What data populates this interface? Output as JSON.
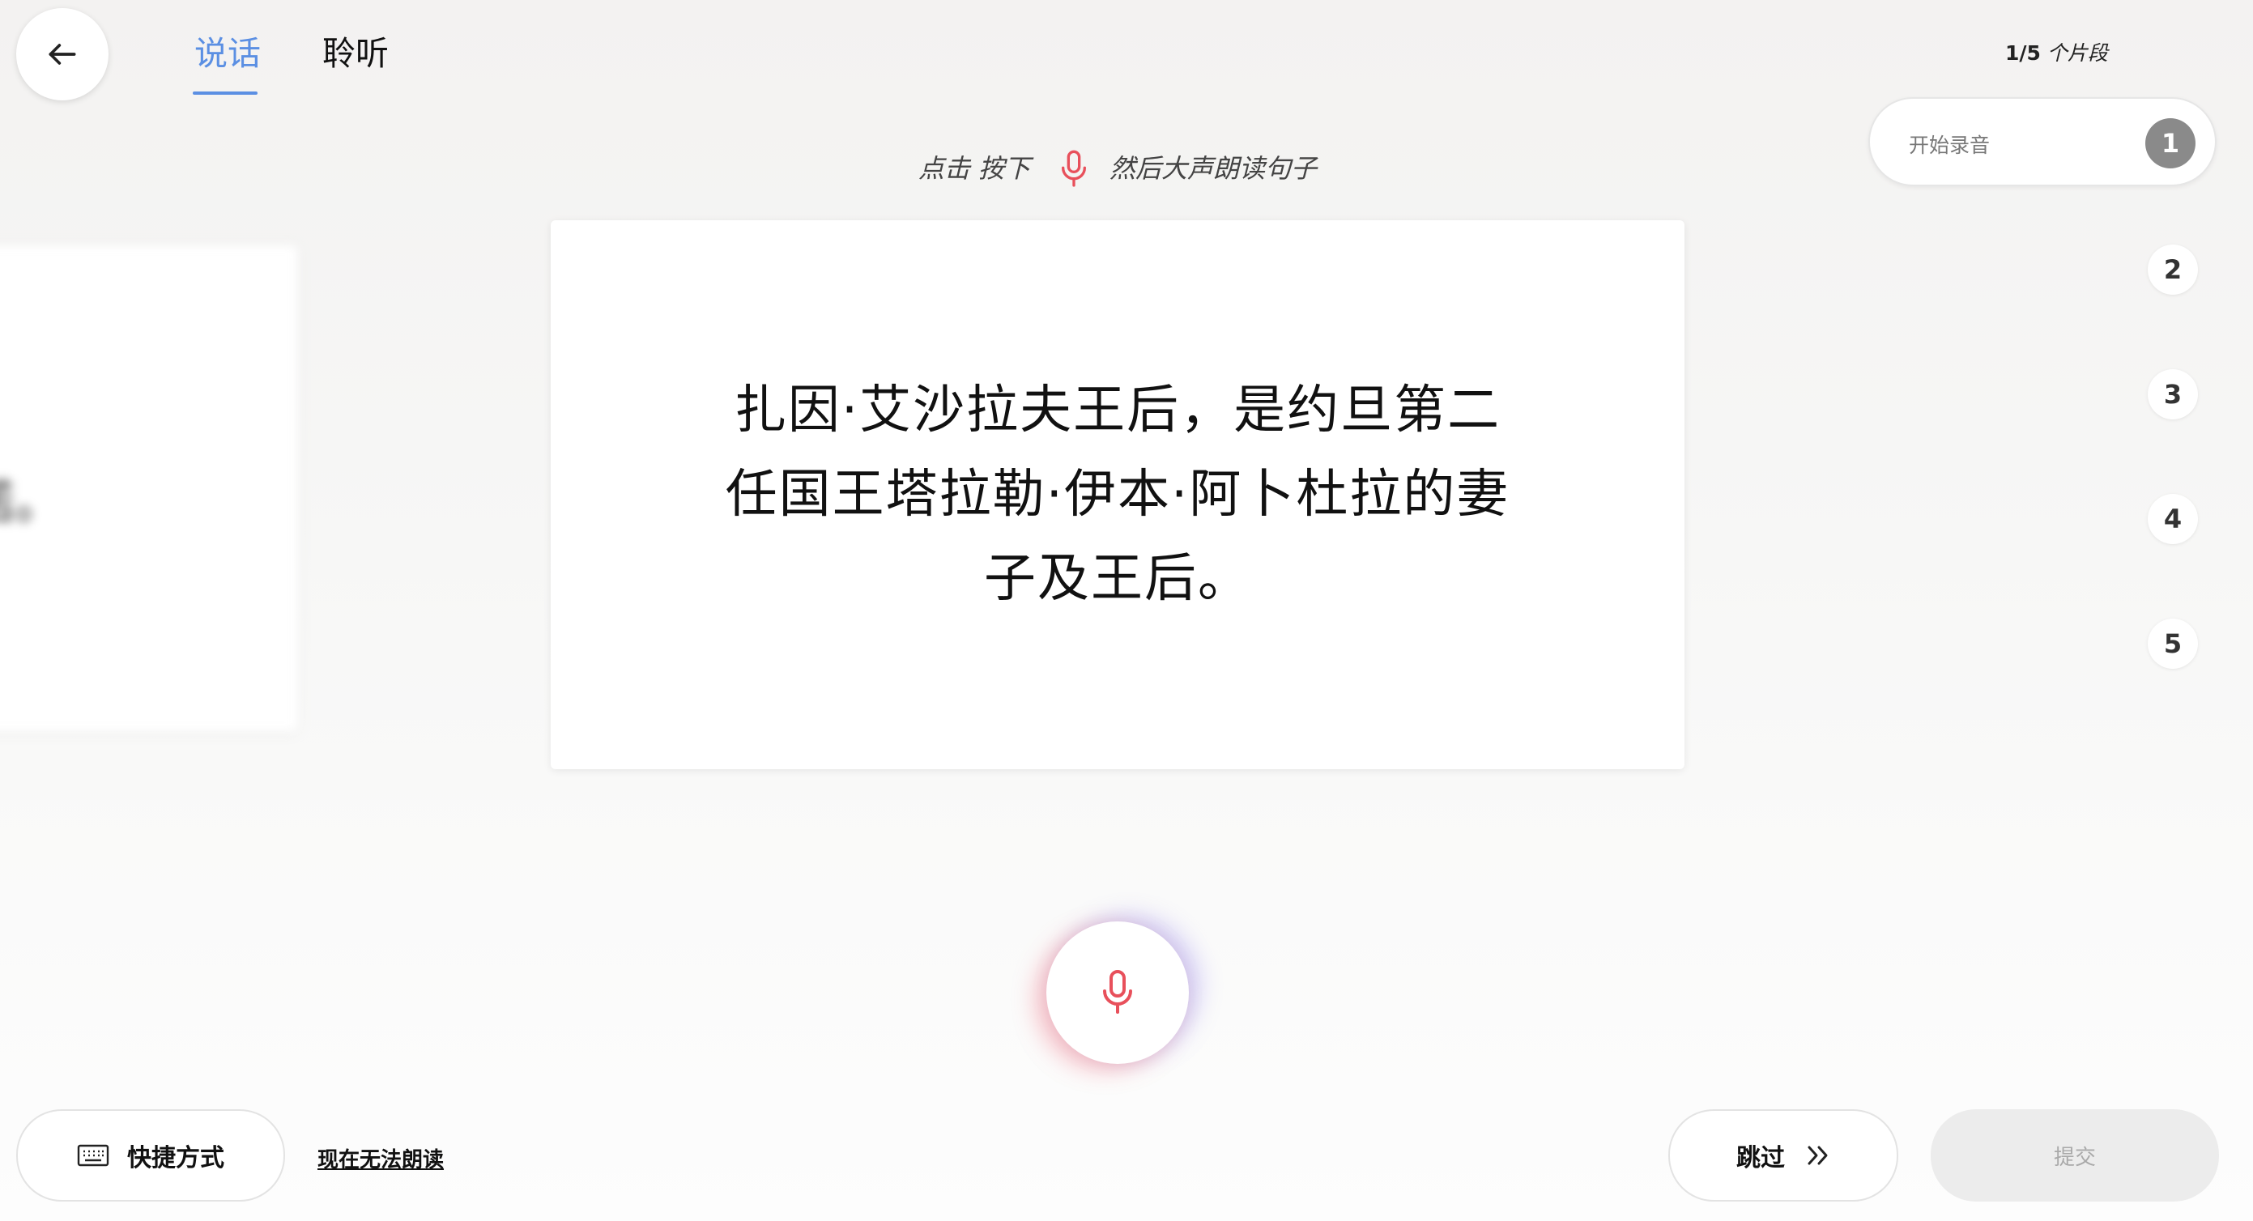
{
  "header": {
    "back_icon": "arrow-left-icon",
    "tabs": [
      {
        "label": "说话",
        "active": true
      },
      {
        "label": "聆听",
        "active": false
      }
    ],
    "progress": {
      "count": "1/5",
      "unit": "个片段"
    }
  },
  "hint": {
    "before": "点击 按下",
    "icon": "microphone-icon",
    "after": "然后大声朗读句子"
  },
  "previous_card": {
    "text_fragment": "诺。"
  },
  "card": {
    "lines": [
      "扎因·艾沙拉夫王后，是约旦第二",
      "任国王塔拉勒·伊本·阿卜杜拉的妻",
      "子及王后。"
    ]
  },
  "steps": {
    "current_label": "开始录音",
    "items": [
      "1",
      "2",
      "3",
      "4",
      "5"
    ]
  },
  "record_button": {
    "icon": "microphone-icon"
  },
  "footer": {
    "shortcuts_label": "快捷方式",
    "shortcuts_icon": "keyboard-icon",
    "cant_read_label": "现在无法朗读",
    "skip_label": "跳过",
    "skip_icon": "double-chevron-right-icon",
    "submit_label": "提交"
  },
  "colors": {
    "accent_blue": "#5b8fe3",
    "mic_red": "#e8505b",
    "step_active": "#8a8a8a"
  }
}
